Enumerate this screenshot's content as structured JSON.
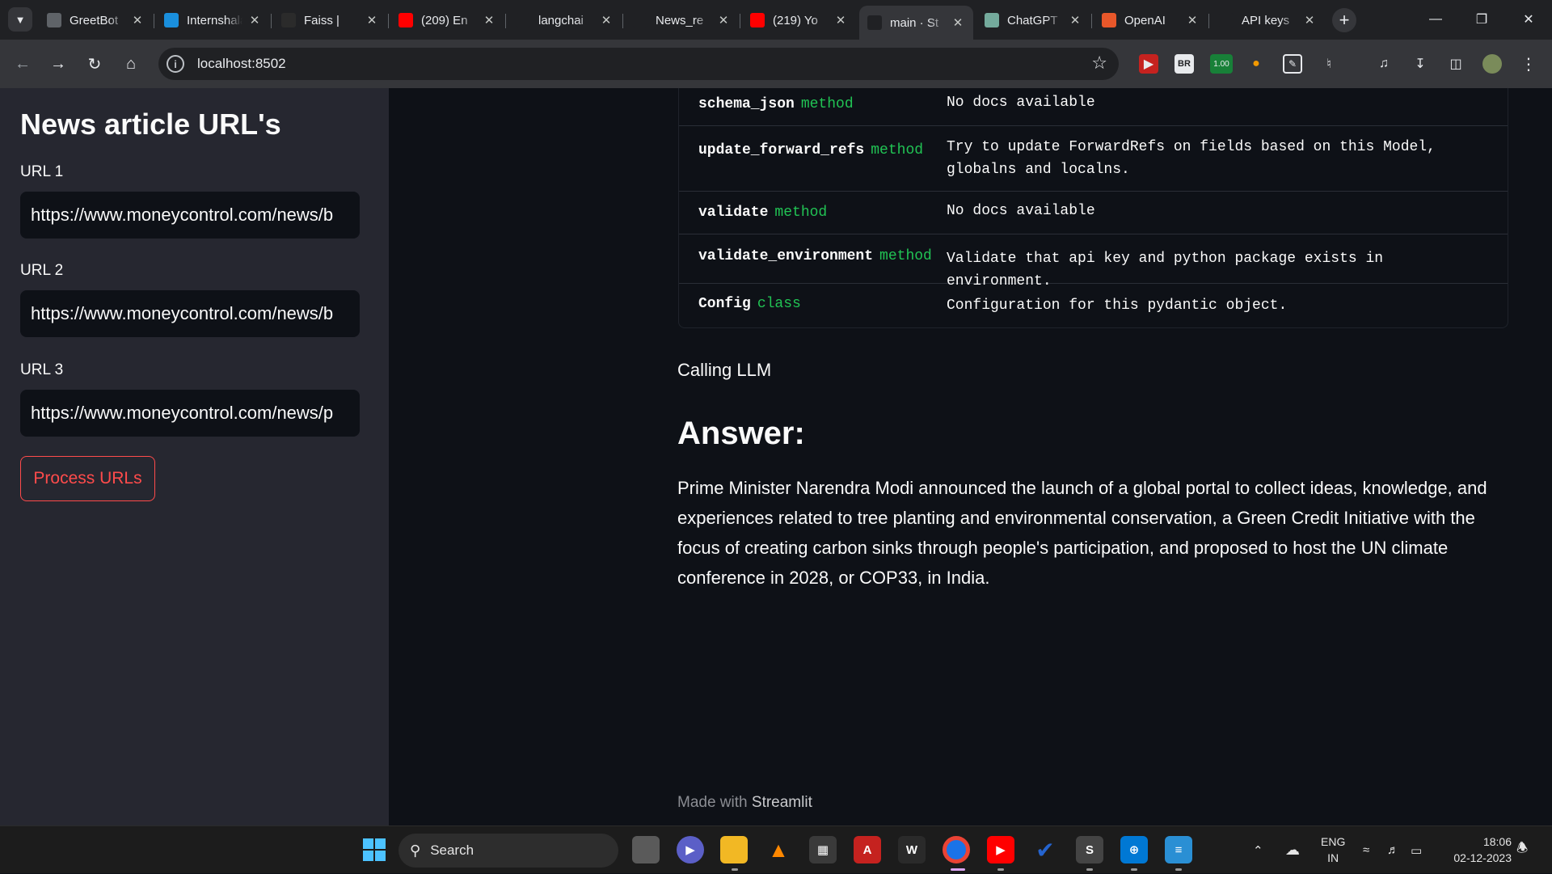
{
  "browser": {
    "tabs": [
      {
        "title": "GreetBot",
        "favicon": "greetbot-icon",
        "color": "#5f6368"
      },
      {
        "title": "Internshala",
        "favicon": "internshala-icon",
        "color": "#1a8fdd"
      },
      {
        "title": "Faiss |",
        "favicon": "faiss-icon",
        "color": "#2b2b2b"
      },
      {
        "title": "(209) En",
        "favicon": "youtube-icon",
        "color": "#ff0000"
      },
      {
        "title": "langchai",
        "favicon": "github-icon",
        "color": "#202124"
      },
      {
        "title": "News_re",
        "favicon": "github-icon",
        "color": "#202124"
      },
      {
        "title": "(219) Yo",
        "favicon": "youtube-icon",
        "color": "#ff0000"
      },
      {
        "title": "main · St",
        "favicon": "streamlit-icon",
        "color": "#202124"
      },
      {
        "title": "ChatGPT",
        "favicon": "chatgpt-icon",
        "color": "#74aa9c"
      },
      {
        "title": "OpenAI",
        "favicon": "openai-icon",
        "color": "#e8572a"
      },
      {
        "title": "API keys",
        "favicon": "openai-icon",
        "color": "#202124"
      }
    ],
    "active_tab_index": 7,
    "address": "localhost:8502"
  },
  "sidebar": {
    "title": "News article URL's",
    "fields": [
      {
        "label": "URL 1",
        "value": "https://www.moneycontrol.com/news/b"
      },
      {
        "label": "URL 2",
        "value": "https://www.moneycontrol.com/news/b"
      },
      {
        "label": "URL 3",
        "value": "https://www.moneycontrol.com/news/p"
      }
    ],
    "button_label": "Process URLs"
  },
  "main": {
    "doc_rows": [
      {
        "name": "schema_json",
        "kind": "method",
        "desc": "No docs available"
      },
      {
        "name": "update_forward_refs",
        "kind": "method",
        "desc": "Try to update ForwardRefs on fields based on this Model, globalns and localns."
      },
      {
        "name": "validate",
        "kind": "method",
        "desc": "No docs available"
      },
      {
        "name": "validate_environment",
        "kind": "method",
        "desc": "Validate that api key and python package exists in environment."
      },
      {
        "name": "Config",
        "kind": "class",
        "desc": "Configuration for this pydantic object."
      }
    ],
    "status": "Calling LLM",
    "answer_heading": "Answer:",
    "answer_text": "Prime Minister Narendra Modi announced the launch of a global portal to collect ideas, knowledge, and experiences related to tree planting and environmental conservation, a Green Credit Initiative with the focus of creating carbon sinks through people's participation, and proposed to host the UN climate conference in 2028, or COP33, in India.",
    "footer_prefix": "Made with",
    "footer_brand": "Streamlit"
  },
  "taskbar": {
    "search_label": "Search",
    "lang_top": "ENG",
    "lang_bottom": "IN",
    "time": "18:06",
    "date": "02-12-2023"
  }
}
